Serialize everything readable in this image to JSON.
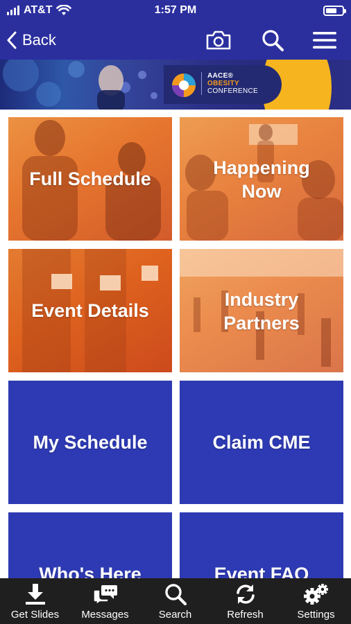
{
  "status_bar": {
    "carrier": "AT&T",
    "time": "1:57 PM",
    "battery_level": 0.7
  },
  "nav": {
    "back_label": "Back",
    "icons": [
      "camera-icon",
      "search-icon",
      "hamburger-menu-icon"
    ],
    "bg_color": "#2b2f9e"
  },
  "banner": {
    "brand_top": "AACE®",
    "brand_accent": "OBESITY",
    "brand_bottom": "CONFERENCE",
    "accent_color": "#f39a1e"
  },
  "tiles": [
    {
      "label": "Full Schedule",
      "style": "photo-orange"
    },
    {
      "label": "Happening Now",
      "label_lines": [
        "Happening",
        "Now"
      ],
      "style": "photo-orange"
    },
    {
      "label": "Event Details",
      "style": "photo-orange"
    },
    {
      "label": "Industry Partners",
      "label_lines": [
        "Industry",
        "Partners"
      ],
      "style": "photo-orange"
    },
    {
      "label": "My Schedule",
      "style": "solid-blue"
    },
    {
      "label": "Claim CME",
      "style": "solid-blue"
    },
    {
      "label": "Who's Here",
      "style": "solid-blue"
    },
    {
      "label": "Event FAQ",
      "style": "solid-blue"
    }
  ],
  "tab_bar": {
    "items": [
      {
        "label": "Get Slides",
        "icon": "download-icon"
      },
      {
        "label": "Messages",
        "icon": "chat-bubbles-icon"
      },
      {
        "label": "Search",
        "icon": "search-icon"
      },
      {
        "label": "Refresh",
        "icon": "refresh-icon"
      },
      {
        "label": "Settings",
        "icon": "gears-icon"
      }
    ],
    "bg_color": "#1f1f1f"
  },
  "colors": {
    "brand_blue": "#2e3ab3",
    "header_blue": "#2b2f9e",
    "tile_orange": "#e2661f"
  }
}
